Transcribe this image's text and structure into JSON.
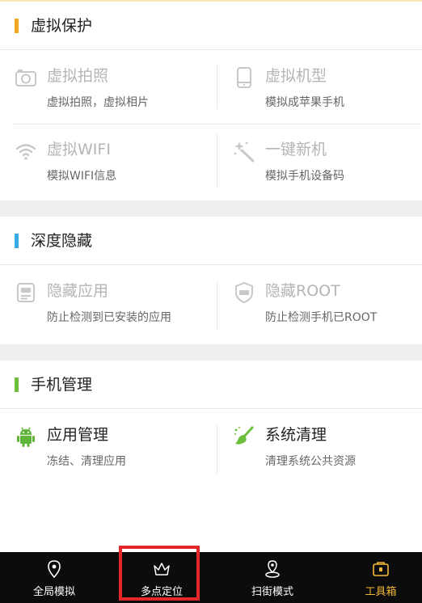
{
  "colors": {
    "orange": "#f5a623",
    "blue": "#3aa9e8",
    "green": "#6cbf3b",
    "android_green": "#5fb53b",
    "inactive_text": "#b5b5b5",
    "active_tab": "#f4b83a",
    "tabbar_bg": "#0c0c0c",
    "highlight": "#e5262b"
  },
  "sections": [
    {
      "title": "虚拟保护",
      "items": [
        {
          "icon": "camera-icon",
          "title": "虚拟拍照",
          "subtitle": "虚拟拍照，虚拟相片"
        },
        {
          "icon": "phone-icon",
          "title": "虚拟机型",
          "subtitle": "模拟成苹果手机"
        },
        {
          "icon": "wifi-icon",
          "title": "虚拟WIFI",
          "subtitle": "模拟WIFI信息"
        },
        {
          "icon": "magic-wand-icon",
          "title": "一键新机",
          "subtitle": "模拟手机设备码"
        }
      ]
    },
    {
      "title": "深度隐藏",
      "items": [
        {
          "icon": "app-icon",
          "title": "隐藏应用",
          "subtitle": "防止检测到已安装的应用"
        },
        {
          "icon": "root-shield-icon",
          "title": "隐藏ROOT",
          "subtitle": "防止检测手机已ROOT"
        }
      ]
    },
    {
      "title": "手机管理",
      "items": [
        {
          "icon": "android-icon",
          "title": "应用管理",
          "subtitle": "冻结、清理应用"
        },
        {
          "icon": "broom-icon",
          "title": "系统清理",
          "subtitle": "清理系统公共资源"
        }
      ]
    }
  ],
  "tabs": [
    {
      "icon": "location-pin-icon",
      "label": "全局模拟",
      "active": false
    },
    {
      "icon": "crown-icon",
      "label": "多点定位",
      "active": false
    },
    {
      "icon": "scan-pin-icon",
      "label": "扫街模式",
      "active": false
    },
    {
      "icon": "toolbox-icon",
      "label": "工具箱",
      "active": true
    }
  ]
}
